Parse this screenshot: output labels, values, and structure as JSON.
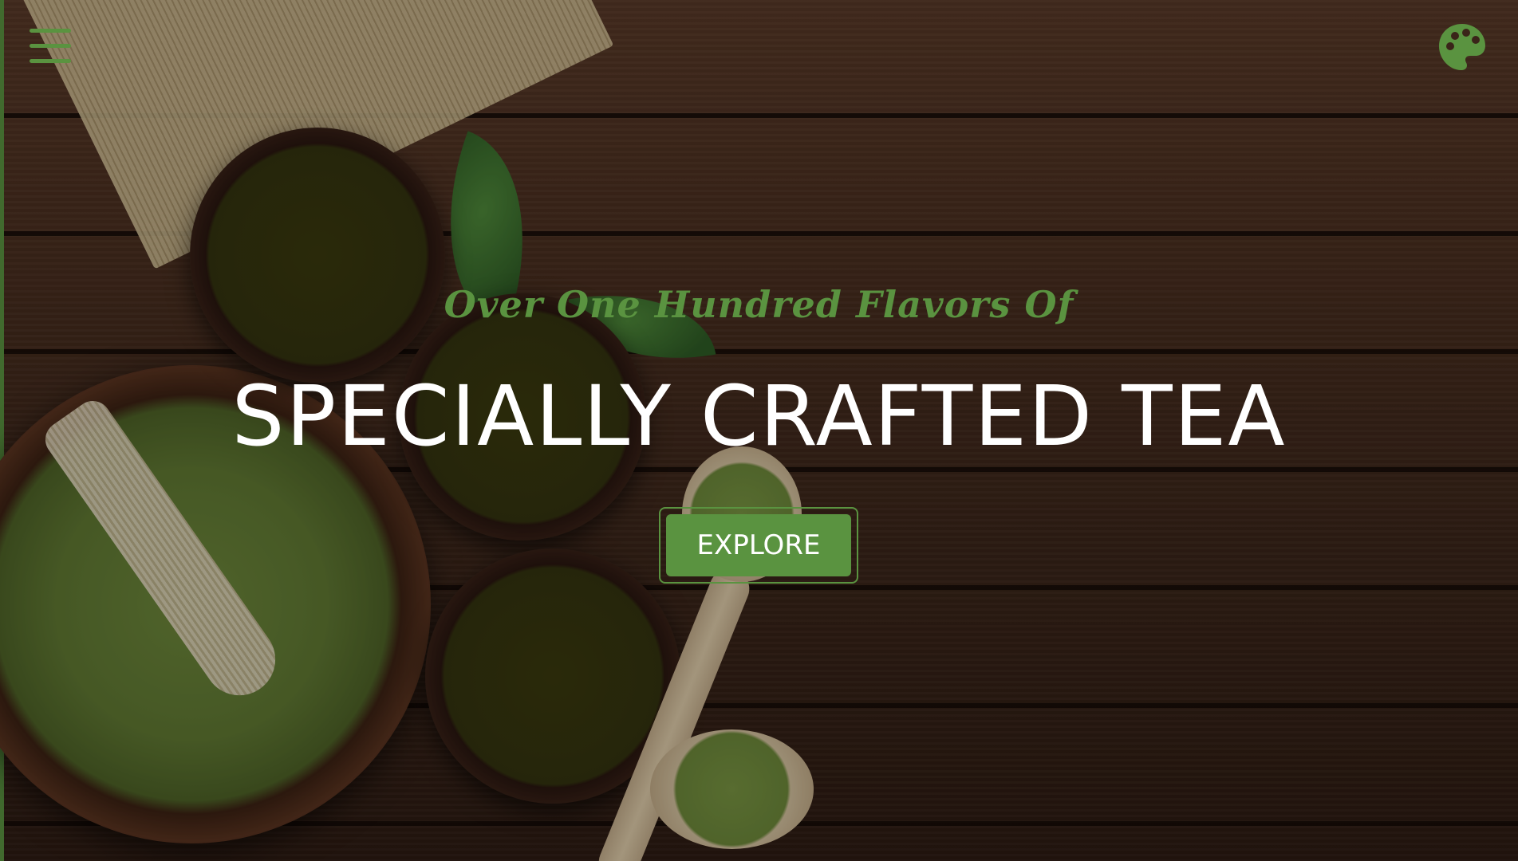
{
  "header": {
    "menu_icon": "hamburger-menu-icon",
    "theme_icon": "palette-icon"
  },
  "hero": {
    "subtitle": "Over One Hundred Flavors Of",
    "title": "SPECIALLY CRAFTED TEA",
    "explore_label": "EXPLORE"
  },
  "colors": {
    "accent": "#5a9340",
    "title": "#ffffff"
  }
}
